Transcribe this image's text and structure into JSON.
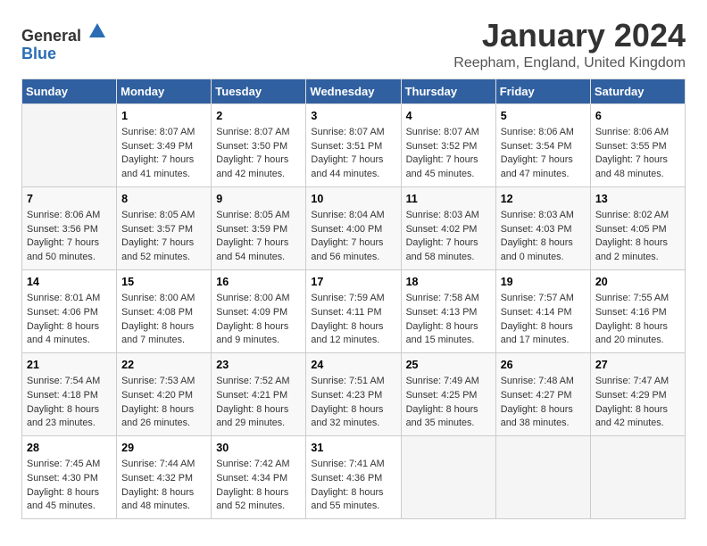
{
  "logo": {
    "general": "General",
    "blue": "Blue"
  },
  "title": "January 2024",
  "location": "Reepham, England, United Kingdom",
  "days_of_week": [
    "Sunday",
    "Monday",
    "Tuesday",
    "Wednesday",
    "Thursday",
    "Friday",
    "Saturday"
  ],
  "weeks": [
    [
      {
        "day": "",
        "info": ""
      },
      {
        "day": "1",
        "info": "Sunrise: 8:07 AM\nSunset: 3:49 PM\nDaylight: 7 hours\nand 41 minutes."
      },
      {
        "day": "2",
        "info": "Sunrise: 8:07 AM\nSunset: 3:50 PM\nDaylight: 7 hours\nand 42 minutes."
      },
      {
        "day": "3",
        "info": "Sunrise: 8:07 AM\nSunset: 3:51 PM\nDaylight: 7 hours\nand 44 minutes."
      },
      {
        "day": "4",
        "info": "Sunrise: 8:07 AM\nSunset: 3:52 PM\nDaylight: 7 hours\nand 45 minutes."
      },
      {
        "day": "5",
        "info": "Sunrise: 8:06 AM\nSunset: 3:54 PM\nDaylight: 7 hours\nand 47 minutes."
      },
      {
        "day": "6",
        "info": "Sunrise: 8:06 AM\nSunset: 3:55 PM\nDaylight: 7 hours\nand 48 minutes."
      }
    ],
    [
      {
        "day": "7",
        "info": "Sunrise: 8:06 AM\nSunset: 3:56 PM\nDaylight: 7 hours\nand 50 minutes."
      },
      {
        "day": "8",
        "info": "Sunrise: 8:05 AM\nSunset: 3:57 PM\nDaylight: 7 hours\nand 52 minutes."
      },
      {
        "day": "9",
        "info": "Sunrise: 8:05 AM\nSunset: 3:59 PM\nDaylight: 7 hours\nand 54 minutes."
      },
      {
        "day": "10",
        "info": "Sunrise: 8:04 AM\nSunset: 4:00 PM\nDaylight: 7 hours\nand 56 minutes."
      },
      {
        "day": "11",
        "info": "Sunrise: 8:03 AM\nSunset: 4:02 PM\nDaylight: 7 hours\nand 58 minutes."
      },
      {
        "day": "12",
        "info": "Sunrise: 8:03 AM\nSunset: 4:03 PM\nDaylight: 8 hours\nand 0 minutes."
      },
      {
        "day": "13",
        "info": "Sunrise: 8:02 AM\nSunset: 4:05 PM\nDaylight: 8 hours\nand 2 minutes."
      }
    ],
    [
      {
        "day": "14",
        "info": "Sunrise: 8:01 AM\nSunset: 4:06 PM\nDaylight: 8 hours\nand 4 minutes."
      },
      {
        "day": "15",
        "info": "Sunrise: 8:00 AM\nSunset: 4:08 PM\nDaylight: 8 hours\nand 7 minutes."
      },
      {
        "day": "16",
        "info": "Sunrise: 8:00 AM\nSunset: 4:09 PM\nDaylight: 8 hours\nand 9 minutes."
      },
      {
        "day": "17",
        "info": "Sunrise: 7:59 AM\nSunset: 4:11 PM\nDaylight: 8 hours\nand 12 minutes."
      },
      {
        "day": "18",
        "info": "Sunrise: 7:58 AM\nSunset: 4:13 PM\nDaylight: 8 hours\nand 15 minutes."
      },
      {
        "day": "19",
        "info": "Sunrise: 7:57 AM\nSunset: 4:14 PM\nDaylight: 8 hours\nand 17 minutes."
      },
      {
        "day": "20",
        "info": "Sunrise: 7:55 AM\nSunset: 4:16 PM\nDaylight: 8 hours\nand 20 minutes."
      }
    ],
    [
      {
        "day": "21",
        "info": "Sunrise: 7:54 AM\nSunset: 4:18 PM\nDaylight: 8 hours\nand 23 minutes."
      },
      {
        "day": "22",
        "info": "Sunrise: 7:53 AM\nSunset: 4:20 PM\nDaylight: 8 hours\nand 26 minutes."
      },
      {
        "day": "23",
        "info": "Sunrise: 7:52 AM\nSunset: 4:21 PM\nDaylight: 8 hours\nand 29 minutes."
      },
      {
        "day": "24",
        "info": "Sunrise: 7:51 AM\nSunset: 4:23 PM\nDaylight: 8 hours\nand 32 minutes."
      },
      {
        "day": "25",
        "info": "Sunrise: 7:49 AM\nSunset: 4:25 PM\nDaylight: 8 hours\nand 35 minutes."
      },
      {
        "day": "26",
        "info": "Sunrise: 7:48 AM\nSunset: 4:27 PM\nDaylight: 8 hours\nand 38 minutes."
      },
      {
        "day": "27",
        "info": "Sunrise: 7:47 AM\nSunset: 4:29 PM\nDaylight: 8 hours\nand 42 minutes."
      }
    ],
    [
      {
        "day": "28",
        "info": "Sunrise: 7:45 AM\nSunset: 4:30 PM\nDaylight: 8 hours\nand 45 minutes."
      },
      {
        "day": "29",
        "info": "Sunrise: 7:44 AM\nSunset: 4:32 PM\nDaylight: 8 hours\nand 48 minutes."
      },
      {
        "day": "30",
        "info": "Sunrise: 7:42 AM\nSunset: 4:34 PM\nDaylight: 8 hours\nand 52 minutes."
      },
      {
        "day": "31",
        "info": "Sunrise: 7:41 AM\nSunset: 4:36 PM\nDaylight: 8 hours\nand 55 minutes."
      },
      {
        "day": "",
        "info": ""
      },
      {
        "day": "",
        "info": ""
      },
      {
        "day": "",
        "info": ""
      }
    ]
  ]
}
